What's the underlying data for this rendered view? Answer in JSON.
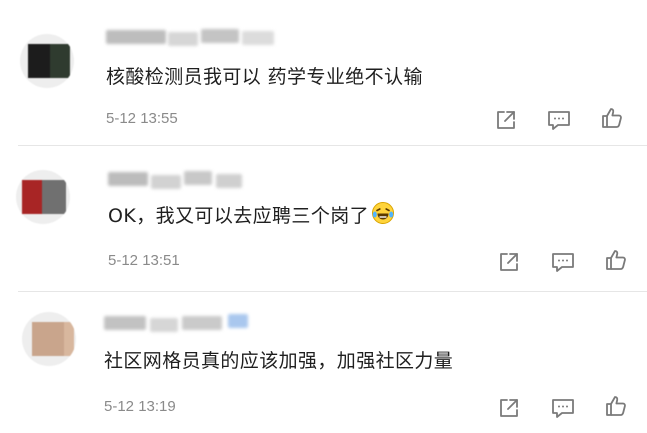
{
  "comments": [
    {
      "text": "核酸检测员我可以 药学专业绝不认输",
      "time": "5-12 13:55",
      "avatar_colors": [
        "#1c1c1c",
        "#2f3b2f"
      ]
    },
    {
      "text": "OK，我又可以去应聘三个岗了",
      "emoji": "laughing-crying-emoji",
      "time": "5-12 13:51",
      "avatar_colors": [
        "#a82525",
        "#707070"
      ]
    },
    {
      "text": "社区网格员真的应该加强，加强社区力量",
      "time": "5-12 13:19",
      "avatar_colors": [
        "#c9a58c",
        "#d8b79e"
      ]
    }
  ],
  "actions": {
    "share_icon": "share-icon",
    "comment_icon": "comment-icon",
    "like_icon": "thumbs-up-icon"
  },
  "colors": {
    "text": "#1f1f1f",
    "meta": "#8a8a8a",
    "icon": "#7a7a7a",
    "divider": "#e6e6e6"
  }
}
